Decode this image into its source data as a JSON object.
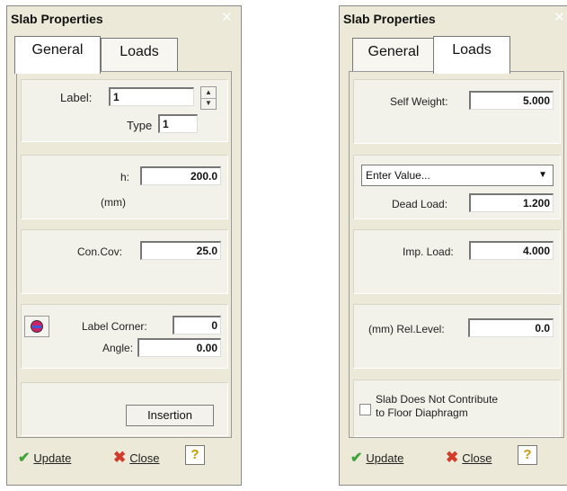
{
  "left_panel": {
    "title": "Slab Properties",
    "close_glyph": "×",
    "tabs": [
      {
        "label": "General"
      },
      {
        "label": "Loads"
      }
    ],
    "label_caption": "Label:",
    "label_value": "1",
    "type_caption": "Type",
    "type_value": "1",
    "h_caption": "h:",
    "h_value": "200.0",
    "h_unit": "(mm)",
    "concov_caption": "Con.Cov:",
    "concov_value": "25.0",
    "label_corner_caption": "Label Corner:",
    "label_corner_value": "0",
    "angle_caption": "Angle:",
    "angle_value": "0.00",
    "insertion_button": "Insertion",
    "update_label": "Update",
    "close_label": "Close",
    "help_glyph": "?"
  },
  "right_panel": {
    "title": "Slab Properties",
    "close_glyph": "×",
    "tabs": [
      {
        "label": "General"
      },
      {
        "label": "Loads"
      }
    ],
    "self_weight_caption": "Self Weight:",
    "self_weight_value": "5.000",
    "dropdown_value": "Enter Value...",
    "dead_load_caption": "Dead Load:",
    "dead_load_value": "1.200",
    "imp_load_caption": "Imp. Load:",
    "imp_load_value": "4.000",
    "rel_level_caption": "(mm) Rel.Level:",
    "rel_level_value": "0.0",
    "diaphragm_line1": "Slab Does Not Contribute",
    "diaphragm_line2": "to Floor Diaphragm",
    "update_label": "Update",
    "close_label": "Close",
    "help_glyph": "?"
  },
  "colors": {
    "panel_bg": "#ece9d8",
    "update_green": "#3fa33a",
    "close_red": "#d23a2a"
  }
}
